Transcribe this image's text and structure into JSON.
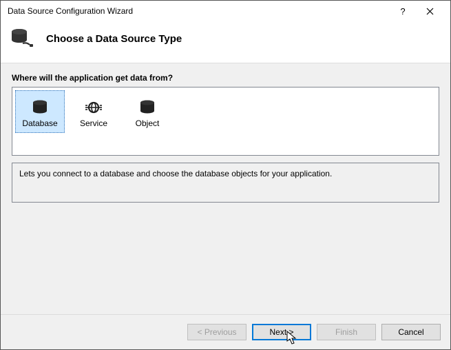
{
  "window": {
    "title": "Data Source Configuration Wizard"
  },
  "header": {
    "heading": "Choose a Data Source Type"
  },
  "body": {
    "prompt": "Where will the application get data from?",
    "options": [
      {
        "label": "Database",
        "selected": true
      },
      {
        "label": "Service",
        "selected": false
      },
      {
        "label": "Object",
        "selected": false
      }
    ],
    "description": "Lets you connect to a database and choose the database objects for your application."
  },
  "footer": {
    "previous": "< Previous",
    "next": "Next >",
    "finish": "Finish",
    "cancel": "Cancel"
  }
}
